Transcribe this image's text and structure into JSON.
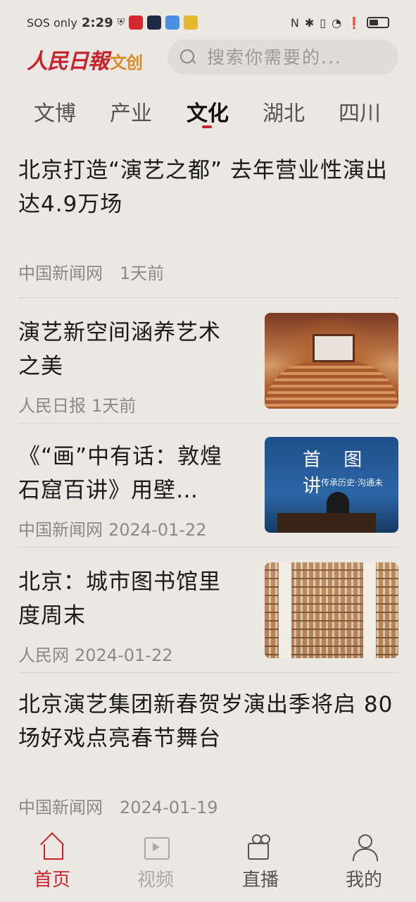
{
  "status_bar": {
    "carrier": "SOS only",
    "time": "2:29",
    "icons": [
      "shield-icon",
      "app-icon",
      "app-icon",
      "app-icon",
      "app-icon",
      "nfc-icon",
      "bluetooth-icon",
      "vibrate-icon",
      "wifi-icon",
      "alert-icon",
      "battery-icon"
    ]
  },
  "header": {
    "logo_main": "人民日報",
    "logo_sub": "文创",
    "search_placeholder": "搜索你需要的..."
  },
  "tabs": [
    {
      "label": "文博"
    },
    {
      "label": "产业"
    },
    {
      "label": "文化",
      "active": true
    },
    {
      "label": "湖北"
    },
    {
      "label": "四川"
    }
  ],
  "articles": [
    {
      "title": "北京打造“演艺之都” 去年营业性演出达4.9万场",
      "source": "中国新闻网",
      "time": "1天前"
    },
    {
      "title": "演艺新空间涵养艺术之美",
      "source": "人民日报",
      "time": "1天前",
      "thumb": "theater"
    },
    {
      "title": "《“画”中有话：敦煌石窟百讲》用壁…",
      "source": "中国新闻网",
      "time": "2024-01-22",
      "thumb": "lecture",
      "thumb_text1": "首 图 讲",
      "thumb_text2": "传承历史·沟通未"
    },
    {
      "title": "北京：城市图书馆里度周末",
      "source": "人民网",
      "time": "2024-01-22",
      "thumb": "library"
    },
    {
      "title": "北京演艺集团新春贺岁演出季将启 80场好戏点亮春节舞台",
      "source": "中国新闻网",
      "time": "2024-01-19"
    }
  ],
  "bottom_nav": [
    {
      "label": "首页",
      "icon": "home-icon",
      "state": "active"
    },
    {
      "label": "视频",
      "icon": "video-icon",
      "state": "disabled"
    },
    {
      "label": "直播",
      "icon": "live-icon",
      "state": "normal"
    },
    {
      "label": "我的",
      "icon": "me-icon",
      "state": "normal"
    }
  ],
  "colors": {
    "accent": "#c8232c",
    "background": "#ebe7e2",
    "logo_sub": "#d98b2b"
  }
}
